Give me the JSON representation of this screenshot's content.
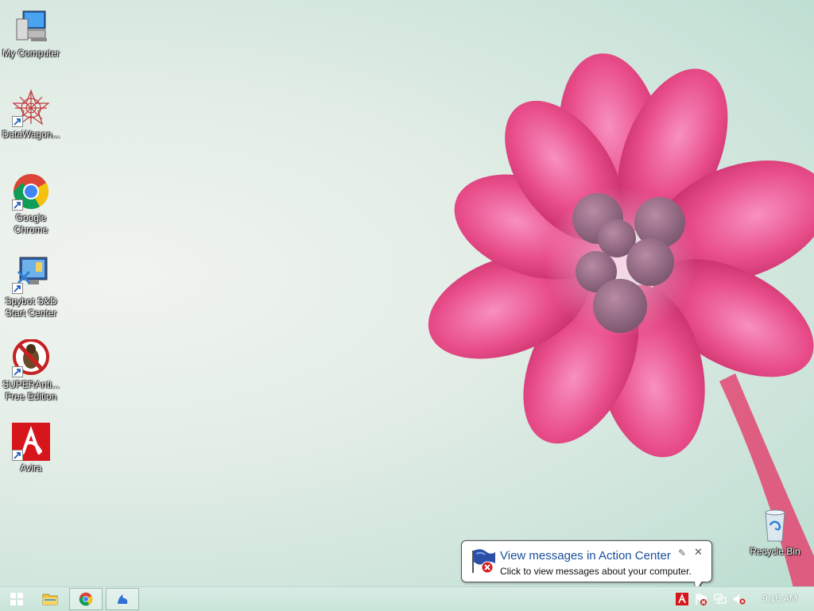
{
  "desktop": {
    "icons": [
      {
        "label": "My Computer",
        "icon": "computer-icon"
      },
      {
        "label": "DataWagon...",
        "icon": "datawagon-icon"
      },
      {
        "label": "Google\nChrome",
        "icon": "chrome-icon"
      },
      {
        "label": "Spybot S&D\nStart Center",
        "icon": "spybot-icon"
      },
      {
        "label": "SUPERAnti...\nFree Edition",
        "icon": "superantispyware-icon"
      },
      {
        "label": "Avira",
        "icon": "avira-icon"
      },
      {
        "label": "Recycle Bin",
        "icon": "recycle-bin-icon"
      }
    ]
  },
  "notification": {
    "title": "View messages in Action Center",
    "body": "Click to view messages about your computer.",
    "options_glyph": "✎",
    "close_glyph": "✕"
  },
  "taskbar": {
    "buttons": [
      "start-button",
      "file-explorer",
      "google-chrome",
      "app-bird"
    ],
    "tray_icons": [
      "avira-tray-icon",
      "action-center-flag-icon",
      "network-icon",
      "volume-muted-icon"
    ],
    "clock": "9:16 AM"
  },
  "colors": {
    "flower_pink": "#e8457f",
    "balloon_title": "#1a4e9a",
    "avira_red": "#d7161c"
  }
}
